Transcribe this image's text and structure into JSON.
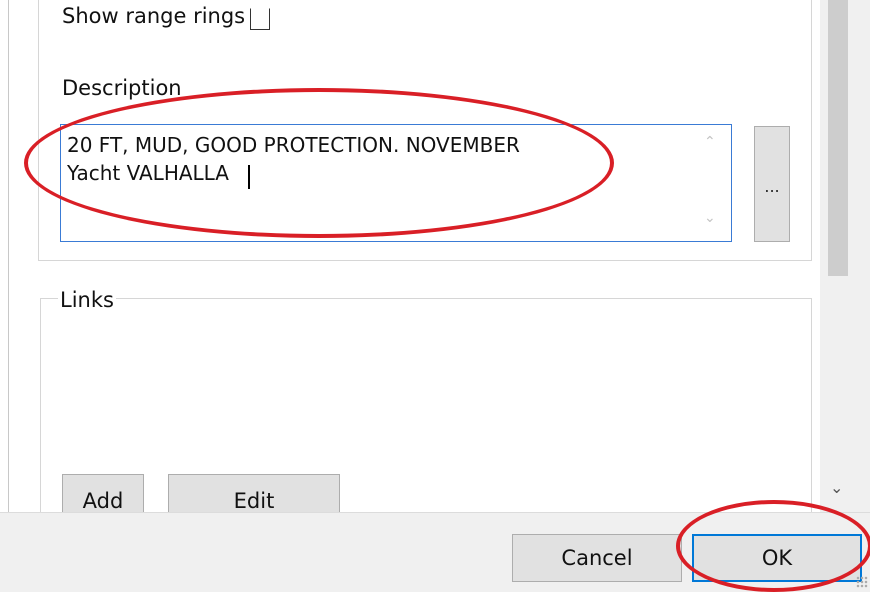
{
  "range_rings": {
    "label": "Show range rings",
    "checked": false
  },
  "description": {
    "label": "Description",
    "value": "20 FT, MUD, GOOD PROTECTION.  NOVEMBER\nYacht VALHALLA",
    "more_button": "..."
  },
  "links": {
    "label": "Links",
    "add_button": "Add",
    "edit_button": "Edit"
  },
  "footer": {
    "cancel_button": "Cancel",
    "ok_button": "OK"
  },
  "icons": {
    "scroll_up": "scroll-up-icon",
    "scroll_down": "scroll-down-icon"
  },
  "colors": {
    "annotation": "#d91f26",
    "focus_border": "#0078d7"
  }
}
